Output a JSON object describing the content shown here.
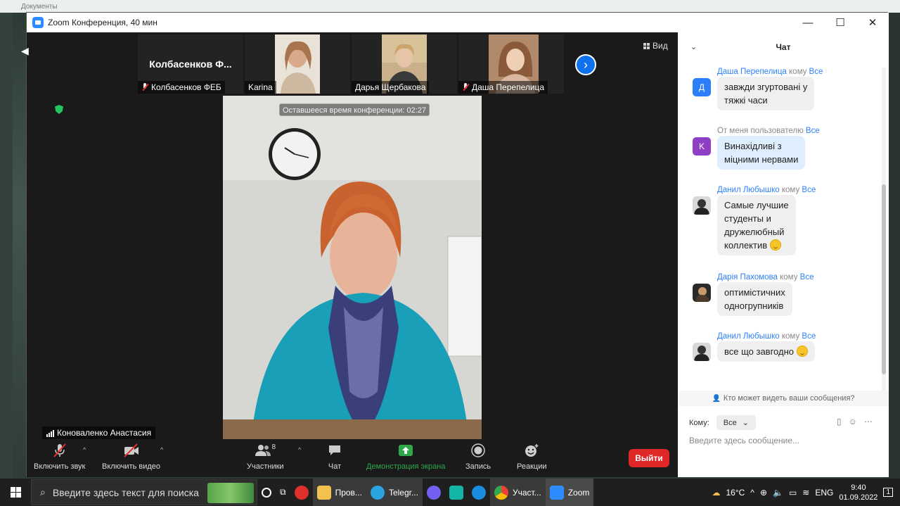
{
  "window": {
    "title": "Zoom Конференция, 40 мин",
    "minimize": "—",
    "maximize": "☐",
    "close": "✕"
  },
  "desktop_top": {
    "label": "Документы"
  },
  "view_button": {
    "label": "Вид"
  },
  "participants_strip": [
    {
      "name": "Колбасенков ФЕБ",
      "big_name": "Колбасенков Ф...",
      "muted": true
    },
    {
      "name": "Karina",
      "muted": false
    },
    {
      "name": "Дарья Щербакова",
      "muted": false
    },
    {
      "name": "Даша Перепелица",
      "muted": true
    }
  ],
  "main_video": {
    "timer": "Оставшееся время конференции: 02:27",
    "active_speaker": "Коноваленко Анастасия"
  },
  "toolbar": {
    "audio": "Включить звук",
    "video": "Включить видео",
    "participants": "Участники",
    "participants_count": "8",
    "chat": "Чат",
    "share": "Демонстрация экрана",
    "record": "Запись",
    "reactions": "Реакции",
    "leave": "Выйти",
    "colors": {
      "share": "#2ea84a",
      "leave": "#e02828"
    }
  },
  "chat": {
    "title": "Чат",
    "messages": [
      {
        "from": "Даша Перепелица",
        "mid": " кому ",
        "to": "Все",
        "avatar": "Д",
        "avatar_color": "#2d7ff9",
        "text1": "завжди згуртовані у",
        "text2": "тяжкі часи",
        "me": false
      },
      {
        "from": "",
        "mid": "От меня пользователю ",
        "to": "Все",
        "avatar": "K",
        "avatar_color": "#8e3fc4",
        "text1": "Винахідливі з",
        "text2": "міцними нервами",
        "me": true
      },
      {
        "from": "Данил Любышко",
        "mid": " кому ",
        "to": "Все",
        "avatar": "",
        "avatar_color": "#333",
        "text1": "Самые лучшие",
        "text2": "студенты и",
        "text3": "дружелюбный",
        "text4": "коллектив",
        "emoji": true,
        "me": false
      },
      {
        "from": "Дарія Пахомова",
        "mid": " кому ",
        "to": "Все",
        "avatar": "",
        "avatar_color": "#2a2a2a",
        "text1": "оптимістичних",
        "text2": "одногрупників",
        "me": false
      },
      {
        "from": "Данил Любышко",
        "mid": " кому ",
        "to": "Все",
        "avatar": "",
        "avatar_color": "#333",
        "text1": "все що завгодно",
        "emoji": true,
        "me": false
      }
    ],
    "who_can_see": "Кто может видеть ваши сообщения?",
    "to_label": "Кому:",
    "to_value": "Все",
    "input_placeholder": "Введите здесь сообщение..."
  },
  "taskbar": {
    "search_placeholder": "Введите здесь текст для поиска",
    "apps": [
      "Пров...",
      "Telegr...",
      "Участ...",
      "Zoom"
    ],
    "weather": "16°C",
    "lang": "ENG",
    "time": "9:40",
    "date": "01.09.2022",
    "notifications": "1"
  }
}
